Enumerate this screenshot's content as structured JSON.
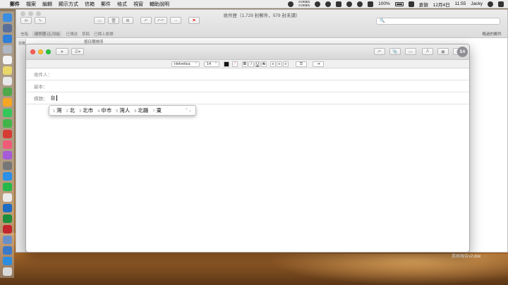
{
  "menubar": {
    "app": "郵件",
    "items": [
      "檔案",
      "編輯",
      "顯示方式",
      "信箱",
      "郵件",
      "格式",
      "視窗",
      "輔助說明"
    ],
    "network_up": "0.0KB/s",
    "network_down": "0.0KB/s",
    "battery": "100%",
    "input_source": "倉頡",
    "date": "12月4日",
    "time": "11:55",
    "user": "Jacky"
  },
  "background_window": {
    "title": "收件匣（1,729 封郵件，579 封未讀）",
    "favorites": [
      "信箱",
      "收件匣 (1,729)",
      "已傳送",
      "草稿",
      "已標上旗標"
    ],
    "right_tag": "略過的郵件",
    "sort_label": "按日期排序",
    "sidebar_label": "信箱",
    "attachment_name": "業務報告v2.doc"
  },
  "compose": {
    "avatar_initials": "SA",
    "font_name": "Helvetica",
    "font_size": "14",
    "to_label": "收件人：",
    "cc_label": "副本：",
    "subject_label": "標題：",
    "subject_value": "台"
  },
  "ime": {
    "candidates": [
      {
        "num": "1",
        "text": "灣"
      },
      {
        "num": "2",
        "text": "北"
      },
      {
        "num": "3",
        "text": "北市"
      },
      {
        "num": "4",
        "text": "中市"
      },
      {
        "num": "5",
        "text": "灣人"
      },
      {
        "num": "6",
        "text": "北縣"
      },
      {
        "num": "7",
        "text": "東"
      }
    ]
  },
  "colors": {
    "close": "#fc5f57",
    "minimize": "#fdbc2e",
    "maximize": "#28c840",
    "flag_red": "#e53935"
  }
}
